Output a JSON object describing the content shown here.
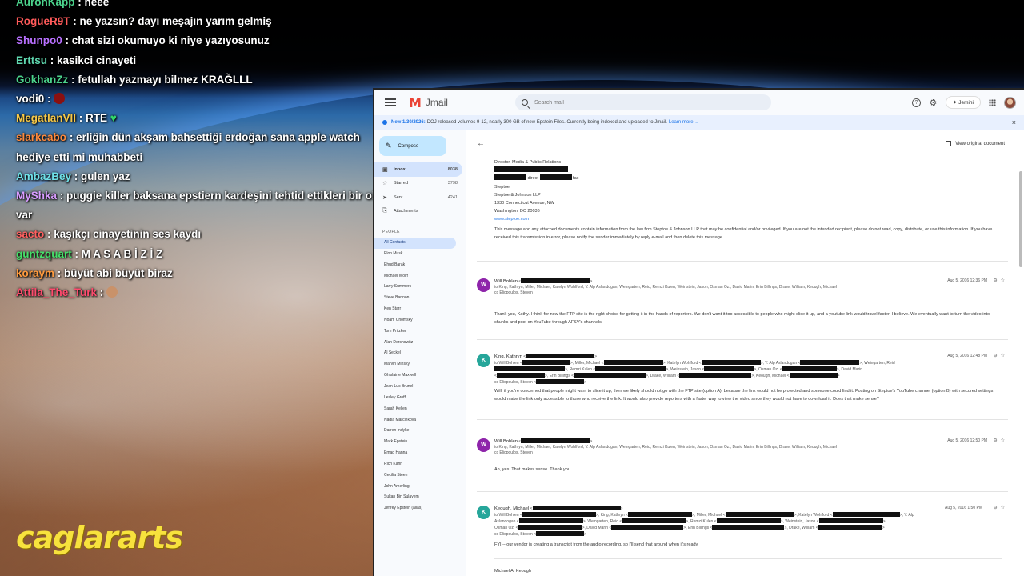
{
  "chat": [
    {
      "user": "AuronKapp",
      "color": "#4bd38c",
      "text": ": neee"
    },
    {
      "user": "RogueR9T",
      "color": "#ff5a5a",
      "text": ": ne yazsın? dayı meşajın yarım gelmiş"
    },
    {
      "user": "Shunpo0",
      "color": "#b870ff",
      "text": ": chat sizi okumuyo ki niye yazıyosunuz"
    },
    {
      "user": "Erttsu",
      "color": "#5fd7b0",
      "text": ": kasikci cinayeti"
    },
    {
      "user": "GokhanZz",
      "color": "#4bd38c",
      "text": ": fetullah yazmayı bilmez KRAĞLLL"
    },
    {
      "user": "vodi0",
      "color": "#ffffff",
      "text": ":",
      "emote": "#8a1010"
    },
    {
      "user": "MegatlanVII",
      "color": "#f7c948",
      "text": ": RTE",
      "emote": "#32d66a"
    },
    {
      "user": "slarkcabo",
      "color": "#ff8a3d",
      "text": ": erliğin dün akşam bahsettiği erdoğan sana apple watch hediye etti mi muhabbeti"
    },
    {
      "user": "AmbazBey",
      "color": "#6fe0e8",
      "text": ": gulen yaz"
    },
    {
      "user": "MyShka",
      "color": "#d89cff",
      "text": ": puggie killer baksana epstiern kardeşini tehtid ettikleri bir olay var"
    },
    {
      "user": "sacto",
      "color": "#ff6060",
      "text": ": kaşıkçı cinayetinin ses kaydı"
    },
    {
      "user": "guntzquart",
      "color": "#46e06a",
      "text": ": M A S A B İ Z İ Z"
    },
    {
      "user": "koraym",
      "color": "#ff9a3d",
      "text": ": büyüt abi büyüt biraz"
    },
    {
      "user": "Attila_The_Turk",
      "color": "#ff4b6e",
      "text": ":",
      "emote": "#c9926a"
    }
  ],
  "brand": "caglararts",
  "jmail": {
    "title": "Jmail",
    "search_placeholder": "Search mail",
    "jemini": "✦ Jemini",
    "help_icon": "?",
    "settings_icon": "⚙",
    "banner": {
      "date": "New 1/30/2026:",
      "text": "DOJ released volumes 9-12, nearly 300 GB of new Epstein Files. Currently being indexed and uploaded to Jmail.",
      "link": "Learn more →",
      "close": "×"
    },
    "compose": "Compose",
    "folders": [
      {
        "icon": "▣",
        "label": "Inbox",
        "count": "8038"
      },
      {
        "icon": "☆",
        "label": "Starred",
        "count": "3798"
      },
      {
        "icon": "➤",
        "label": "Sent",
        "count": "4241"
      },
      {
        "icon": "⎘",
        "label": "Attachments",
        "count": ""
      }
    ],
    "people_header": "PEOPLE",
    "people": [
      "All Contacts",
      "Elon Musk",
      "Ehud Barak",
      "Michael Wolff",
      "Larry Summers",
      "Steve Bannon",
      "Ken Starr",
      "Noam Chomsky",
      "Tom Pritzker",
      "Alan Dershowitz",
      "Al Seckel",
      "Marvin Minsky",
      "Ghislaine Maxwell",
      "Jean-Luc Brunel",
      "Lesley Groff",
      "Sarah Kellen",
      "Nadia Marcinkova",
      "Darren Indyke",
      "Mark Epstein",
      "Emad Hanna",
      "Rich Kahn",
      "Cecilia Steen",
      "John Amerling",
      "Sultan Bin Sulayem",
      "Jeffrey Epstein (alias)"
    ],
    "view_original": "View original document",
    "signature": {
      "title": "Director, Media & Public Relations",
      "direct": "direct",
      "fax": "fax",
      "firm1": "Steptoe",
      "firm2": "Steptoe & Johnson LLP",
      "addr1": "1330 Connecticut Avenue, NW",
      "addr2": "Washington, DC 20036",
      "web": "www.steptoe.com",
      "disclaimer": "This message and any attached documents contain information from the law firm Steptoe & Johnson LLP that may be confidential and/or privileged. If you are not the intended recipient, please do not read, copy, distribute, or use this information. If you have received this transmission in error, please notify the sender immediately by reply e-mail and then delete this message."
    },
    "emails": [
      {
        "initial": "W",
        "color": "#8e24aa",
        "from": "Will Bohlen",
        "to": "to King, Kathryn, Miller, Michael, Katelyn Wohlford, Y. Alp Aslandogan, Weingarten, Reid, Remzi Kulen, Weinstein, Jason, Osman Oz., David Marin, Erin Billings, Drake, William, Keough, Michael",
        "cc": "cc Eliopoulos, Steven",
        "date": "Aug 5, 2016 12:36 PM",
        "body": "Thank you, Kathy. I think for now the FTP site is the right choice for getting it in the hands of reporters. We don't want it too accessible to people who might slice it up, and a youtube link would travel faster, I believe. We eventually want to turn the video into chunks and post on YouTube through AFSV's channels."
      },
      {
        "initial": "K",
        "color": "#26a69a",
        "from": "King, Kathryn",
        "to": "to Will Bohlen",
        "to2": ", Miller, Michael",
        "to3": ", Katelyn Wohlford",
        "to4": ", Y. Alp Aslandogan",
        "to5": ", Weingarten, Reid",
        "to6": ", Remzi Kulen",
        "to7": ", Weinstein, Jason",
        "to8": ", Osman Oz.",
        "to9": ", David Marin",
        "to10": ", Erin Billings",
        "to11": ", Drake, William",
        "to12": ", Keough, Michael",
        "cc": "cc Eliopoulos, Steven",
        "date": "Aug 5, 2016 12:48 PM",
        "body": "Will, if you're concerned that people might want to slice it up, then we likely should not go with the FTP site (option A), because the link would not be protected and someone could find it. Posting on Steptoe's YouTube channel (option B) with secured settings would make the link only accessible to those who receive the link. It would also provide reporters with a faster way to view the video since they would not have to download it. Does that make sense?"
      },
      {
        "initial": "W",
        "color": "#8e24aa",
        "from": "Will Bohlen",
        "to": "to King, Kathryn, Miller, Michael, Katelyn Wohlford, Y. Alp Aslandogan, Weingarten, Reid, Remzi Kulen, Weinstein, Jason, Osman Oz., David Marin, Erin Billings, Drake, William, Keough, Michael",
        "cc": "cc Eliopoulos, Steven",
        "date": "Aug 5, 2016 12:50 PM",
        "body": "Ah, yes. That makes sense. Thank you."
      },
      {
        "initial": "K",
        "color": "#26a69a",
        "from": "Keough, Michael",
        "to": "to Will Bohlen",
        "to2": ", King, Kathryn",
        "to3": ", Miller, Michael",
        "to4": ", Katelyn Wohlford",
        "to5": ", Y. Alp",
        "to6": "Aslandogan",
        "to7": ", Weingarten, Reid",
        "to8": ", Remzi Kulen",
        "to9": ", Weinstein, Jason",
        "to10": "Osman Oz.",
        "to11": ", David Marin",
        "to12": ", Erin Billings",
        "to13": ", Drake, William",
        "cc": "cc Eliopoulos, Steven",
        "date": "Aug 5, 2016 1:50 PM",
        "body": "FYI -- our vendor is creating a transcript from the audio recording, so I'll send that around when it's ready.",
        "sig": "Michael A. Keough"
      }
    ]
  }
}
